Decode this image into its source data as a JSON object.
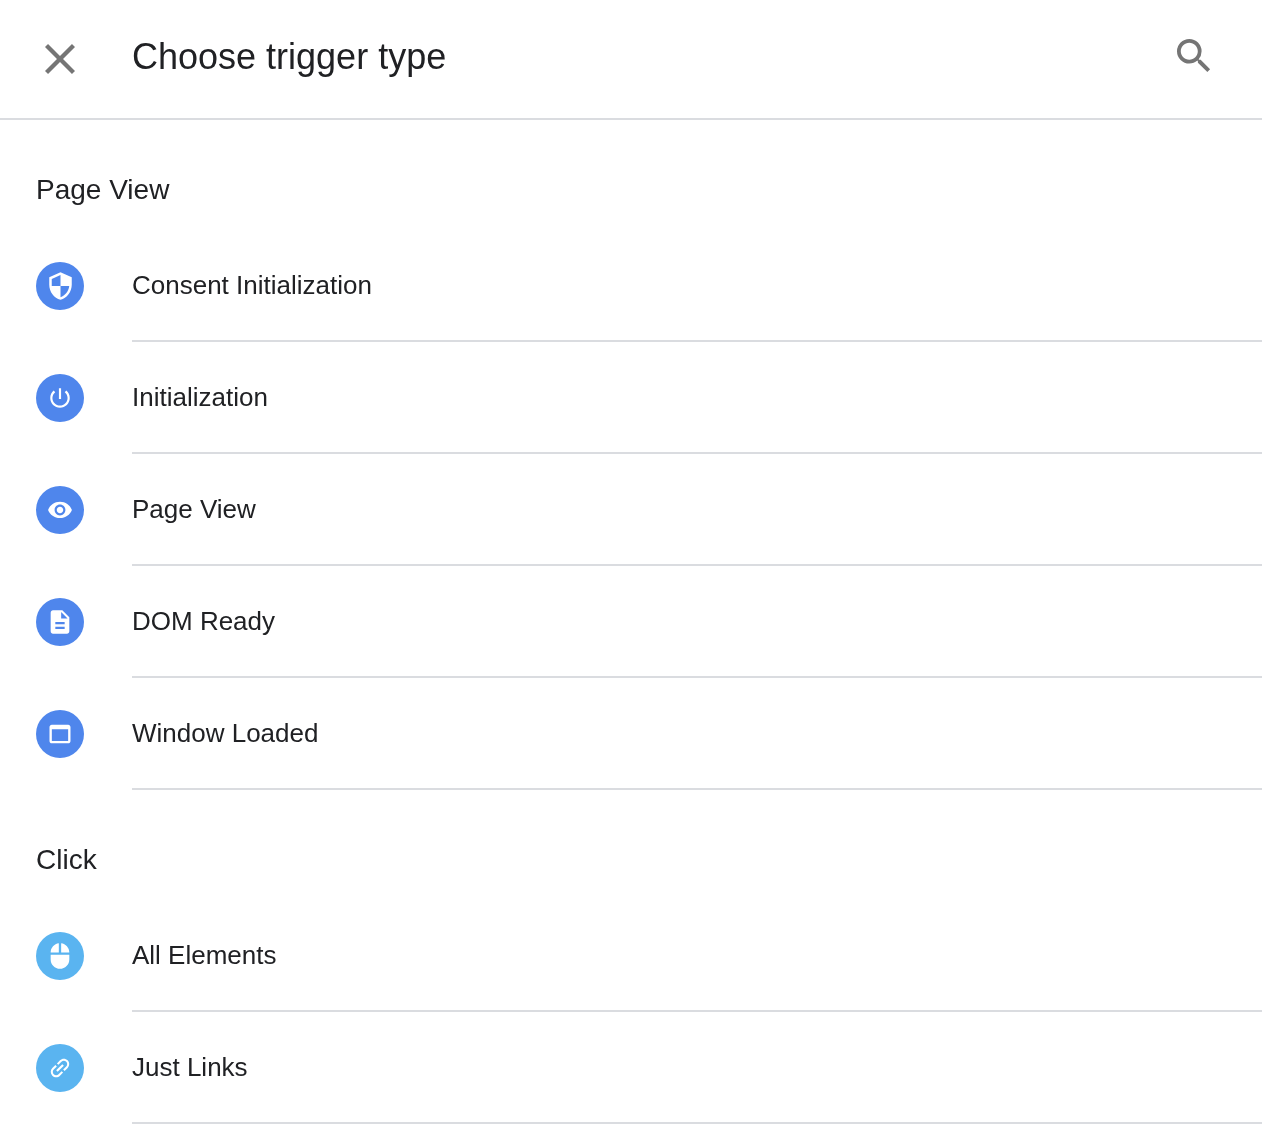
{
  "header": {
    "title": "Choose trigger type"
  },
  "sections": [
    {
      "heading": "Page View",
      "items": [
        {
          "label": "Consent Initialization",
          "kind": "shield",
          "color": "#4f86ec"
        },
        {
          "label": "Initialization",
          "kind": "power",
          "color": "#4f86ec"
        },
        {
          "label": "Page View",
          "kind": "eye",
          "color": "#4f86ec"
        },
        {
          "label": "DOM Ready",
          "kind": "document",
          "color": "#4f86ec"
        },
        {
          "label": "Window Loaded",
          "kind": "window",
          "color": "#4f86ec"
        }
      ]
    },
    {
      "heading": "Click",
      "items": [
        {
          "label": "All Elements",
          "kind": "mouse",
          "color": "#5ab4f0"
        },
        {
          "label": "Just Links",
          "kind": "link",
          "color": "#5ab4f0"
        }
      ]
    }
  ]
}
